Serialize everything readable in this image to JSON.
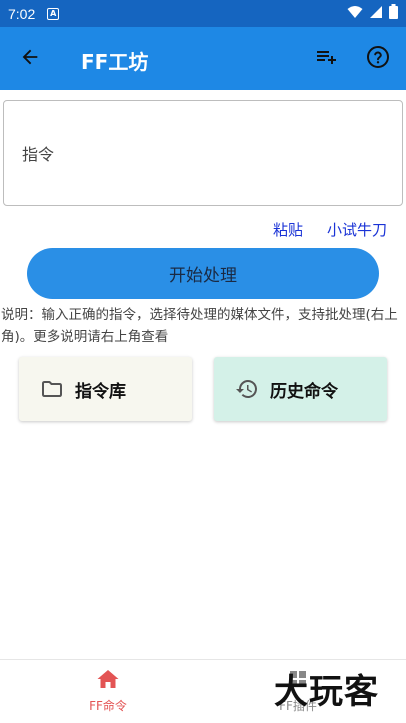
{
  "status_bar": {
    "time": "7:02",
    "notification_icon": "A",
    "icons": [
      "wifi-icon",
      "signal-icon",
      "battery-icon"
    ]
  },
  "app_bar": {
    "title": "FF工坊",
    "back_icon": "arrow-left-icon",
    "actions": [
      "playlist-add-icon",
      "help-circle-icon"
    ]
  },
  "command_input": {
    "placeholder": "指令",
    "value": ""
  },
  "links": {
    "paste": "粘贴",
    "try": "小试牛刀"
  },
  "start_button": {
    "label": "开始处理"
  },
  "description": "说明：输入正确的指令，选择待处理的媒体文件，支持批处理(右上角)。更多说明请右上角查看",
  "cards": [
    {
      "label": "指令库",
      "icon": "folder-icon"
    },
    {
      "label": "历史命令",
      "icon": "history-icon"
    }
  ],
  "bottom_nav": [
    {
      "label": "FF命令",
      "icon": "home-icon",
      "active": true
    },
    {
      "label": "FF插件",
      "icon": "plugin-icon",
      "active": false
    }
  ],
  "watermark": "大玩客",
  "colors": {
    "status_bar": "#1565c0",
    "app_bar": "#1e88e5",
    "start_button": "#2a8fe6",
    "link": "#1a33d6",
    "active_nav": "#e35454",
    "card_library": "#f7f7ef",
    "card_history": "#d4f1e8"
  }
}
